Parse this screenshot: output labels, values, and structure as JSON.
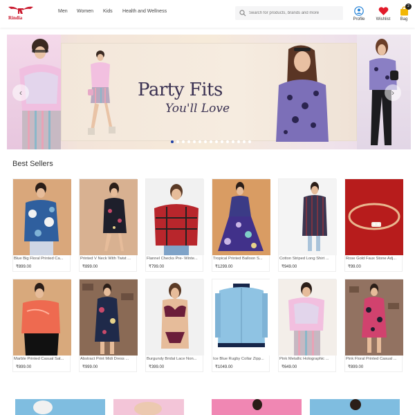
{
  "brand": {
    "logo_text": "Rindia",
    "accent": "#c9162b"
  },
  "nav": [
    "Men",
    "Women",
    "Kids",
    "Health and Wellness"
  ],
  "search": {
    "placeholder": "Search for products, brands and more",
    "icon": "search-icon"
  },
  "actions": {
    "profile": {
      "label": "Profile",
      "icon": "user-icon"
    },
    "wishlist": {
      "label": "Wishlist",
      "icon": "heart-icon"
    },
    "bag": {
      "label": "Bag",
      "icon": "bag-icon",
      "count": "2"
    }
  },
  "hero": {
    "title": "Party Fits",
    "subtitle": "You'll Love",
    "slide_count": 15,
    "active_slide": 1
  },
  "best_sellers": {
    "title": "Best Sellers",
    "products": [
      {
        "name": "Blue Big Floral Printed Ca...",
        "price": "₹899.00"
      },
      {
        "name": "Printed V Neck With Twist ...",
        "price": "₹899.00"
      },
      {
        "name": "Flannel Checks Pre- Winte...",
        "price": "₹799.00"
      },
      {
        "name": "Tropical Printed Balloon S...",
        "price": "₹1299.00"
      },
      {
        "name": "Cotton Striped Long Shirt ...",
        "price": "₹949.00"
      },
      {
        "name": "Rose Gold Faux Stone Adj...",
        "price": "₹99.00"
      },
      {
        "name": "Marble Printed Casual Sat...",
        "price": "₹899.00"
      },
      {
        "name": "Abstract Print Midi Dress ...",
        "price": "₹999.00"
      },
      {
        "name": "Burgundy Bridal Lace Non...",
        "price": "₹399.00"
      },
      {
        "name": "Ice Blue Rugby Collar Zipp...",
        "price": "₹1049.00"
      },
      {
        "name": "Pink Metallic Holographic ...",
        "price": "₹649.00"
      },
      {
        "name": "Pink Floral Printed Casual ...",
        "price": "₹899.00"
      }
    ]
  }
}
